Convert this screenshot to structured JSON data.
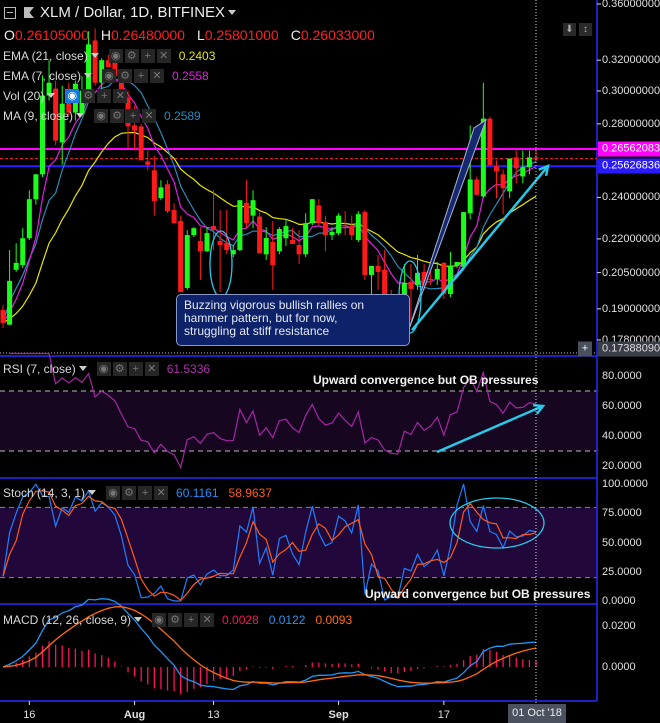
{
  "header": {
    "title": "XLM / Dollar, 1D, BITFINEX"
  },
  "ohlc": {
    "o_label": "O",
    "o": "0.26105000",
    "h_label": "H",
    "h": "0.26480000",
    "l_label": "L",
    "l": "0.25801000",
    "c_label": "C",
    "c": "0.26033000"
  },
  "legend": {
    "ema21": {
      "label": "EMA (21, close)",
      "value": "0.2403"
    },
    "ema7": {
      "label": "EMA (7, close)",
      "value": "0.2558"
    },
    "vol": {
      "label": "Vol (20)"
    },
    "ma9": {
      "label": "MA (9, close)",
      "value": "0.2589"
    },
    "rsi": {
      "label": "RSI (7, close)",
      "value": "61.5336"
    },
    "stoch": {
      "label": "Stoch (14, 3, 1)",
      "k": "60.1161",
      "d": "58.9637"
    },
    "macd": {
      "label": "MACD (12, 26, close, 9)",
      "hist": "0.0028",
      "macd": "0.0122",
      "signal": "0.0093"
    }
  },
  "annotations": {
    "note_lines": [
      "Buzzing vigorous bullish rallies on",
      "hammer pattern, but for now,",
      "struggling at stiff resistance"
    ],
    "rsi_text": "Upward convergence but OB pressures",
    "stoch_text": "Upward convergence but OB pressures"
  },
  "colors": {
    "up": "#1aff1a",
    "down": "#ff1a1a",
    "ema21": "#e6e600",
    "ema7": "#e020e0",
    "ma9": "#2a8ab8",
    "rsi": "#a626a6",
    "stoch_k": "#1e7fff",
    "stoch_d": "#ff5a1a",
    "macd": "#2196f3",
    "signal": "#ff6a10",
    "hist": "#ff1060",
    "cyan": "#27c8e8",
    "level_magenta": "#ff00ff",
    "level_blue": "#2a1aff"
  },
  "chart_data": {
    "type": "candlestick",
    "title": "XLM / Dollar, 1D, BITFINEX",
    "candles": [
      [
        0.1896,
        0.1916,
        0.1826,
        0.1845
      ],
      [
        0.1838,
        0.2149,
        0.1835,
        0.2015
      ],
      [
        0.2062,
        0.218,
        0.2053,
        0.2092
      ],
      [
        0.2083,
        0.225,
        0.207,
        0.2203
      ],
      [
        0.2203,
        0.2436,
        0.2195,
        0.2391
      ],
      [
        0.2391,
        0.252,
        0.2364,
        0.2519
      ],
      [
        0.2519,
        0.31,
        0.2505,
        0.2971
      ],
      [
        0.2971,
        0.32,
        0.294,
        0.3052
      ],
      [
        0.3015,
        0.3066,
        0.2678,
        0.2704
      ],
      [
        0.2693,
        0.3033,
        0.257,
        0.2921
      ],
      [
        0.294,
        0.3052,
        0.2849,
        0.2867
      ],
      [
        0.2867,
        0.3066,
        0.282,
        0.3046
      ],
      [
        0.2861,
        0.3095,
        0.2849,
        0.3002
      ],
      [
        0.3002,
        0.34,
        0.2989,
        0.3308
      ],
      [
        0.3335,
        0.342,
        0.3034,
        0.3052
      ],
      [
        0.3052,
        0.3213,
        0.2952,
        0.32
      ],
      [
        0.32,
        0.3236,
        0.3152,
        0.3153
      ],
      [
        0.3185,
        0.3236,
        0.3089,
        0.3095
      ],
      [
        0.3066,
        0.3095,
        0.2952,
        0.2952
      ],
      [
        0.2958,
        0.3002,
        0.2659,
        0.2785
      ],
      [
        0.2791,
        0.2909,
        0.2648,
        0.2761
      ],
      [
        0.2785,
        0.28,
        0.2594,
        0.2594
      ],
      [
        0.2588,
        0.2648,
        0.254,
        0.257
      ],
      [
        0.254,
        0.262,
        0.231,
        0.2381
      ],
      [
        0.2396,
        0.2488,
        0.2386,
        0.2451
      ],
      [
        0.2467,
        0.2488,
        0.2322,
        0.2332
      ],
      [
        0.2337,
        0.237,
        0.2274,
        0.2274
      ],
      [
        0.2284,
        0.231,
        0.1968,
        0.1968
      ],
      [
        0.1985,
        0.2241,
        0.1977,
        0.2218
      ],
      [
        0.2218,
        0.2255,
        0.2208,
        0.225
      ],
      [
        0.219,
        0.2255,
        0.2019,
        0.2144
      ],
      [
        0.2144,
        0.2255,
        0.214,
        0.2227
      ],
      [
        0.226,
        0.2436,
        0.2149,
        0.2241
      ],
      [
        0.219,
        0.2337,
        0.1968,
        0.2172
      ],
      [
        0.2181,
        0.2337,
        0.213,
        0.2149
      ],
      [
        0.213,
        0.2172,
        0.2118,
        0.2149
      ],
      [
        0.2149,
        0.2386,
        0.2144,
        0.2386
      ],
      [
        0.2372,
        0.2488,
        0.225,
        0.2274
      ],
      [
        0.231,
        0.2436,
        0.225,
        0.2386
      ],
      [
        0.2306,
        0.2327,
        0.2135,
        0.2135
      ],
      [
        0.213,
        0.2255,
        0.2105,
        0.2204
      ],
      [
        0.2186,
        0.2284,
        0.1977,
        0.2083
      ],
      [
        0.2144,
        0.2255,
        0.213,
        0.2246
      ],
      [
        0.2203,
        0.2288,
        0.2168,
        0.226
      ],
      [
        0.2195,
        0.225,
        0.2177,
        0.2177
      ],
      [
        0.2172,
        0.2241,
        0.2087,
        0.213
      ],
      [
        0.213,
        0.2322,
        0.2118,
        0.2274
      ],
      [
        0.2274,
        0.2391,
        0.2264,
        0.2391
      ],
      [
        0.236,
        0.2391,
        0.2264,
        0.2274
      ],
      [
        0.2279,
        0.231,
        0.2144,
        0.2218
      ],
      [
        0.2218,
        0.2255,
        0.2195,
        0.2232
      ],
      [
        0.2227,
        0.2322,
        0.2218,
        0.231
      ],
      [
        0.2264,
        0.2332,
        0.2218,
        0.226
      ],
      [
        0.226,
        0.231,
        0.2195,
        0.2218
      ],
      [
        0.2195,
        0.2332,
        0.2186,
        0.2317
      ],
      [
        0.2327,
        0.2337,
        0.2019,
        0.204
      ],
      [
        0.204,
        0.2079,
        0.1936,
        0.2079
      ],
      [
        0.2079,
        0.2127,
        0.1977,
        0.2053
      ],
      [
        0.2062,
        0.2149,
        0.1936,
        0.194
      ],
      [
        0.1936,
        0.1977,
        0.1876,
        0.1896
      ],
      [
        0.1904,
        0.1936,
        0.1876,
        0.1889
      ],
      [
        0.1908,
        0.2087,
        0.1857,
        0.2006
      ],
      [
        0.201,
        0.2087,
        0.1857,
        0.1981
      ],
      [
        0.1998,
        0.2127,
        0.1977,
        0.2049
      ],
      [
        0.2053,
        0.2087,
        0.1977,
        0.1998
      ],
      [
        0.2023,
        0.2062,
        0.1998,
        0.2019
      ],
      [
        0.2023,
        0.2096,
        0.1998,
        0.2066
      ],
      [
        0.2092,
        0.2096,
        0.194,
        0.196
      ],
      [
        0.196,
        0.214,
        0.1948,
        0.2079
      ],
      [
        0.2079,
        0.2096,
        0.207,
        0.2096
      ],
      [
        0.2075,
        0.2327,
        0.2062,
        0.2327
      ],
      [
        0.2322,
        0.2791,
        0.2293,
        0.2492
      ],
      [
        0.2492,
        0.2507,
        0.2413,
        0.2413
      ],
      [
        0.2405,
        0.3052,
        0.2396,
        0.2831
      ],
      [
        0.2831,
        0.2843,
        0.2567,
        0.2567
      ],
      [
        0.2562,
        0.2594,
        0.2396,
        0.2535
      ],
      [
        0.2519,
        0.2546,
        0.2317,
        0.2447
      ],
      [
        0.2431,
        0.2604,
        0.2396,
        0.2604
      ],
      [
        0.261,
        0.2648,
        0.2473,
        0.2551
      ],
      [
        0.2508,
        0.2648,
        0.2473,
        0.2557
      ],
      [
        0.2557,
        0.2648,
        0.2519,
        0.261
      ],
      [
        0.26105,
        0.2648,
        0.25801,
        0.26033
      ]
    ],
    "y_scale": "log",
    "y_ticks": [
      {
        "value": 0.36,
        "label": "0.36000000"
      },
      {
        "value": 0.32,
        "label": "0.32000000"
      },
      {
        "value": 0.3,
        "label": "0.30000000"
      },
      {
        "value": 0.28,
        "label": "0.28000000"
      },
      {
        "value": 0.24,
        "label": "0.24000000"
      },
      {
        "value": 0.22,
        "label": "0.22000000"
      },
      {
        "value": 0.205,
        "label": "0.20500000"
      },
      {
        "value": 0.19,
        "label": "0.19000000"
      },
      {
        "value": 0.178,
        "label": "0.17800000"
      }
    ],
    "levels": [
      {
        "value": 0.26562083,
        "label": "0.26562083",
        "color": "#ff00ff"
      },
      {
        "value": 0.25626836,
        "label": "0.25626836",
        "color": "#2a1aff"
      }
    ],
    "current_price": 0.26033,
    "crosshair_price": {
      "value": 0.1738809,
      "label": "0.17388090"
    },
    "x_ticks": [
      {
        "index": 4,
        "label": "16"
      },
      {
        "index": 20,
        "label": "Aug"
      },
      {
        "index": 32,
        "label": "13"
      },
      {
        "index": 51,
        "label": "Sep"
      },
      {
        "index": 67,
        "label": "17"
      }
    ],
    "x_cursor": {
      "index": 81,
      "label": "01 Oct '18"
    },
    "rsi_axis": [
      {
        "value": 80,
        "label": "80.0000"
      },
      {
        "value": 60,
        "label": "60.0000"
      },
      {
        "value": 40,
        "label": "40.0000"
      },
      {
        "value": 20,
        "label": "20.0000"
      }
    ],
    "rsi_bands": [
      30,
      70
    ],
    "stoch_axis": [
      {
        "value": 100,
        "label": "100.0000"
      },
      {
        "value": 75,
        "label": "75.0000"
      },
      {
        "value": 50,
        "label": "50.0000"
      },
      {
        "value": 25,
        "label": "25.0000"
      },
      {
        "value": 0,
        "label": "0.0000"
      }
    ],
    "stoch_bands": [
      20,
      80
    ],
    "macd_axis": [
      {
        "value": 0.02,
        "label": "0.0200"
      },
      {
        "value": 0,
        "label": "0.0000"
      }
    ]
  }
}
